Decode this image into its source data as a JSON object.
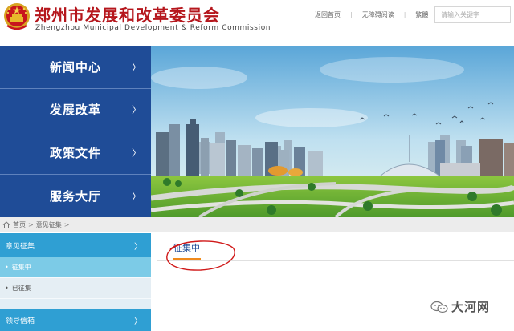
{
  "header": {
    "site_title": "郑州市发展和改革委员会",
    "site_subtitle": "Zhengzhou Municipal Development & Reform Commission",
    "links": {
      "home": "返回首页",
      "accessible": "无障碍阅读",
      "traditional": "繁體"
    },
    "search_placeholder": "请输入关键字"
  },
  "main_nav": [
    {
      "label": "新闻中心"
    },
    {
      "label": "发展改革"
    },
    {
      "label": "政策文件"
    },
    {
      "label": "服务大厅"
    }
  ],
  "breadcrumb": {
    "home": "首页",
    "separator": ">",
    "current": "意见征集",
    "trailing": ">"
  },
  "side_menu": {
    "section_title": "意见征集",
    "items": [
      {
        "label": "征集中",
        "active": true
      },
      {
        "label": "已征集",
        "active": false
      }
    ],
    "next_section": "领导信箱"
  },
  "content": {
    "active_tab": "征集中"
  },
  "watermark": {
    "text": "大河网"
  },
  "colors": {
    "title_red": "#b5161c",
    "nav_blue": "#1f4c97",
    "submenu_blue": "#2f9fd3",
    "active_light_blue": "#7ccbe7",
    "tab_underline_orange": "#f08a1c",
    "annotation_red": "#d01818"
  },
  "icons": {
    "emblem": "national-emblem-icon",
    "home": "home-icon",
    "chevron": "chevron-right-icon",
    "watermark": "wechat-icon"
  }
}
